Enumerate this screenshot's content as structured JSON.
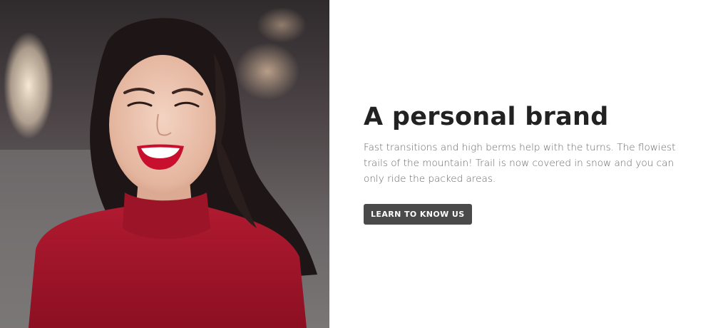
{
  "hero": {
    "image_alt": "Smiling woman in red turtleneck",
    "headline": "A personal brand",
    "body": "Fast transitions and high berms help with the turns. The flowiest trails of the mountain! Trail is now covered in snow and you can only ride the packed areas.",
    "cta_label": "LEARN TO KNOW US"
  },
  "colors": {
    "headline": "#222222",
    "body": "#666666",
    "button_bg": "#4a4a4a",
    "button_text": "#ffffff",
    "sweater": "#a5142a",
    "lips": "#c8102e"
  }
}
